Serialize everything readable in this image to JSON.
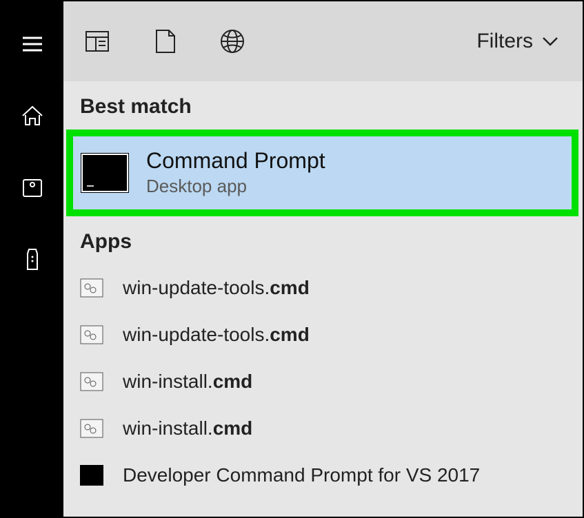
{
  "filters_label": "Filters",
  "sections": {
    "best_match": "Best match",
    "apps": "Apps"
  },
  "best_match": {
    "title": "Command Prompt",
    "subtitle": "Desktop app"
  },
  "apps": [
    {
      "base": "win-update-tools.",
      "ext": "cmd",
      "icon": "cmd-file-icon"
    },
    {
      "base": "win-update-tools.",
      "ext": "cmd",
      "icon": "cmd-file-icon"
    },
    {
      "base": "win-install.",
      "ext": "cmd",
      "icon": "cmd-file-icon"
    },
    {
      "base": "win-install.",
      "ext": "cmd",
      "icon": "cmd-file-icon"
    },
    {
      "base": "Developer Command Prompt for VS 2017",
      "ext": "",
      "icon": "dev-cmd-icon"
    }
  ],
  "sidebar": [
    {
      "name": "hamburger-icon"
    },
    {
      "name": "home-icon"
    },
    {
      "name": "camera-icon"
    },
    {
      "name": "remote-icon"
    }
  ],
  "topbar_icons": [
    {
      "name": "recent-doc-icon"
    },
    {
      "name": "file-icon"
    },
    {
      "name": "web-icon"
    }
  ]
}
